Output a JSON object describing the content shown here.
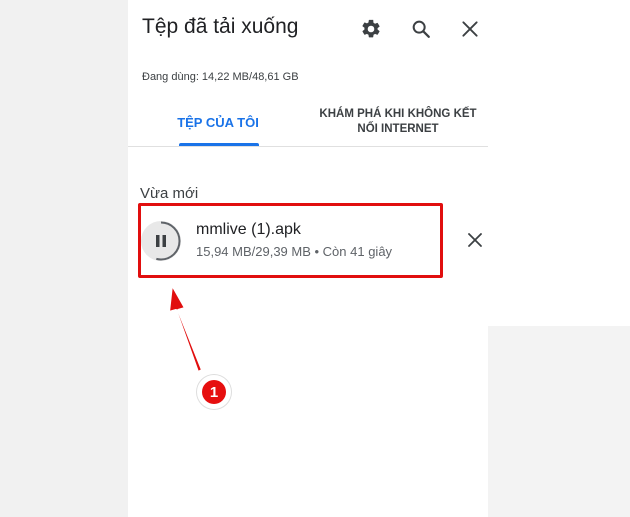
{
  "header": {
    "title": "Tệp đã tải xuống",
    "icons": [
      "gear-icon",
      "search-icon",
      "close-icon"
    ]
  },
  "storage": {
    "text": "Đang dùng: 14,22 MB/48,61 GB"
  },
  "tabs": [
    {
      "label": "TỆP CỦA TÔI",
      "active": true
    },
    {
      "label_line1": "KHÁM PHÁ KHI KHÔNG KẾT",
      "label_line2": "NỐI INTERNET",
      "active": false
    }
  ],
  "section": {
    "title": "Vừa mới"
  },
  "download": {
    "name": "mmlive (1).apk",
    "status": "15,94 MB/29,39 MB • Còn 41 giây",
    "progress": 0.54,
    "state_icon": "pause-icon"
  },
  "annotation": {
    "badge": "1"
  },
  "colors": {
    "accent": "#1a73e8",
    "annotation": "#e10e0e"
  }
}
